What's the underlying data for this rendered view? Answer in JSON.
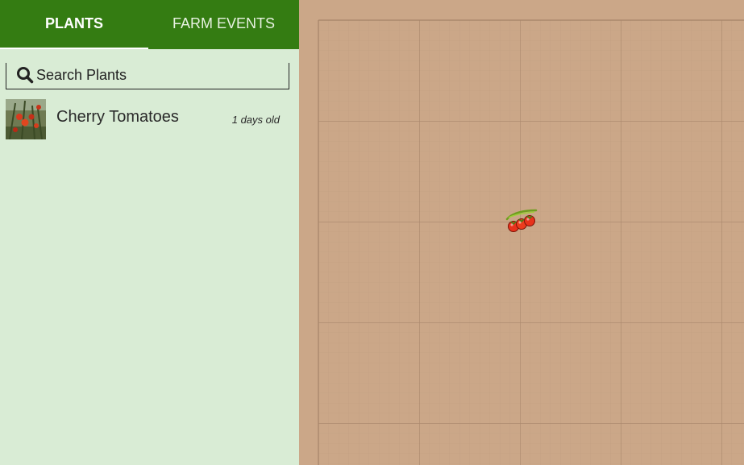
{
  "tabs": [
    {
      "label": "PLANTS",
      "active": true
    },
    {
      "label": "FARM EVENTS",
      "active": false
    }
  ],
  "search": {
    "placeholder": "Search Plants",
    "value": ""
  },
  "plants": [
    {
      "name": "Cherry Tomatoes",
      "age": "1 days old",
      "icon": "tomato-photo"
    }
  ],
  "map": {
    "soil_color": "#cba788",
    "grid_color": "#b08f74",
    "icon": "cherry-tomato-icon"
  },
  "colors": {
    "header": "#347c12",
    "sidebar": "#d9ecd5"
  }
}
